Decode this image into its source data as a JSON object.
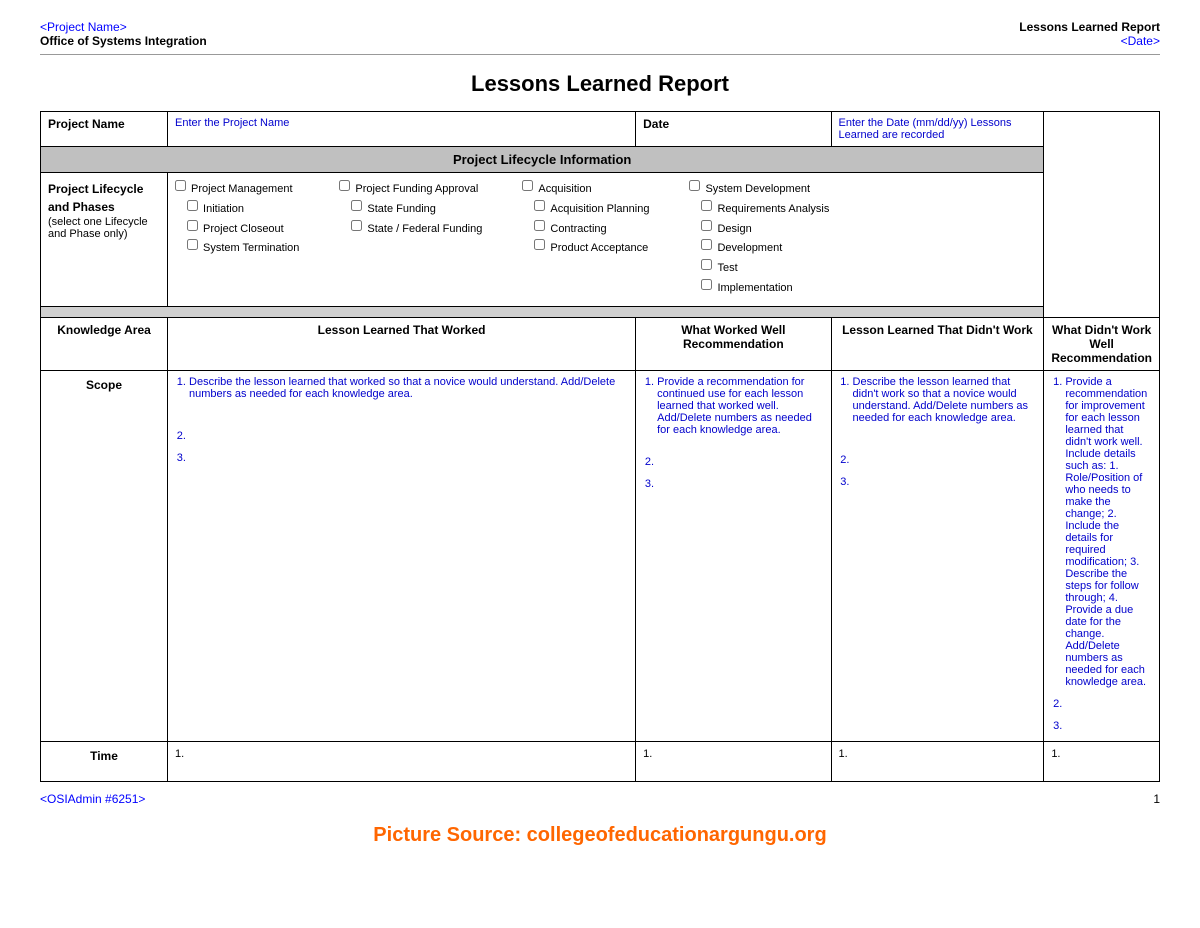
{
  "header": {
    "project_link": "<Project Name>",
    "org_name": "Office of Systems Integration",
    "report_title": "Lessons Learned Report",
    "date_link": "<Date>"
  },
  "main_title": "Lessons Learned Report",
  "project_name_label": "Project Name",
  "project_name_placeholder": "Enter the Project Name",
  "date_label": "Date",
  "date_placeholder": "Enter the Date (mm/dd/yy) Lessons Learned are recorded",
  "lifecycle_section_header": "Project Lifecycle Information",
  "lifecycle_label": "Project Lifecycle and Phases",
  "lifecycle_note": "(select one Lifecycle and Phase only)",
  "checkboxes_col1": [
    "Project Management",
    "Initiation",
    "Project Closeout",
    "System Termination"
  ],
  "checkboxes_col2": [
    "Project Funding Approval",
    "State Funding",
    "State / Federal Funding"
  ],
  "checkboxes_col3": [
    "Acquisition",
    "Acquisition Planning",
    "Contracting",
    "Product Acceptance"
  ],
  "checkboxes_col4": [
    "System Development",
    "Requirements Analysis",
    "Design",
    "Development",
    "Test",
    "Implementation"
  ],
  "table_headers": {
    "knowledge_area": "Knowledge Area",
    "lesson_worked": "Lesson Learned That Worked",
    "what_worked_rec": "What Worked Well Recommendation",
    "lesson_didnt_work": "Lesson Learned That Didn't Work",
    "what_didnt_work_rec": "What Didn't Work Well Recommendation"
  },
  "scope_row": {
    "area": "Scope",
    "worked_items": [
      "Describe the lesson learned that worked so that a novice would understand. Add/Delete numbers as needed for each knowledge area.",
      "",
      ""
    ],
    "worked_rec_items": [
      "Provide a recommendation for continued use for each lesson learned that worked well. Add/Delete numbers as needed for each knowledge area.",
      "",
      ""
    ],
    "didnt_work_items": [
      "Describe the lesson learned that didn't work so that a novice would understand. Add/Delete numbers as needed for each knowledge area.",
      "",
      ""
    ],
    "didnt_work_rec_items": [
      "Provide a recommendation for improvement for each lesson learned that didn't work well. Include details such as: 1. Role/Position of who needs to make the change; 2. Include the details for required modification; 3. Describe the steps for follow through; 4. Provide a due date for the change. Add/Delete numbers as needed for each knowledge area.",
      "",
      ""
    ]
  },
  "time_row": {
    "area": "Time",
    "worked": "1.",
    "worked_rec": "1.",
    "didnt_work": "1.",
    "didnt_work_rec": "1."
  },
  "footer": {
    "admin_link": "<OSIAdmin #6251>",
    "page_number": "1"
  },
  "watermark": "Picture Source: collegeofeducationargungu.org"
}
